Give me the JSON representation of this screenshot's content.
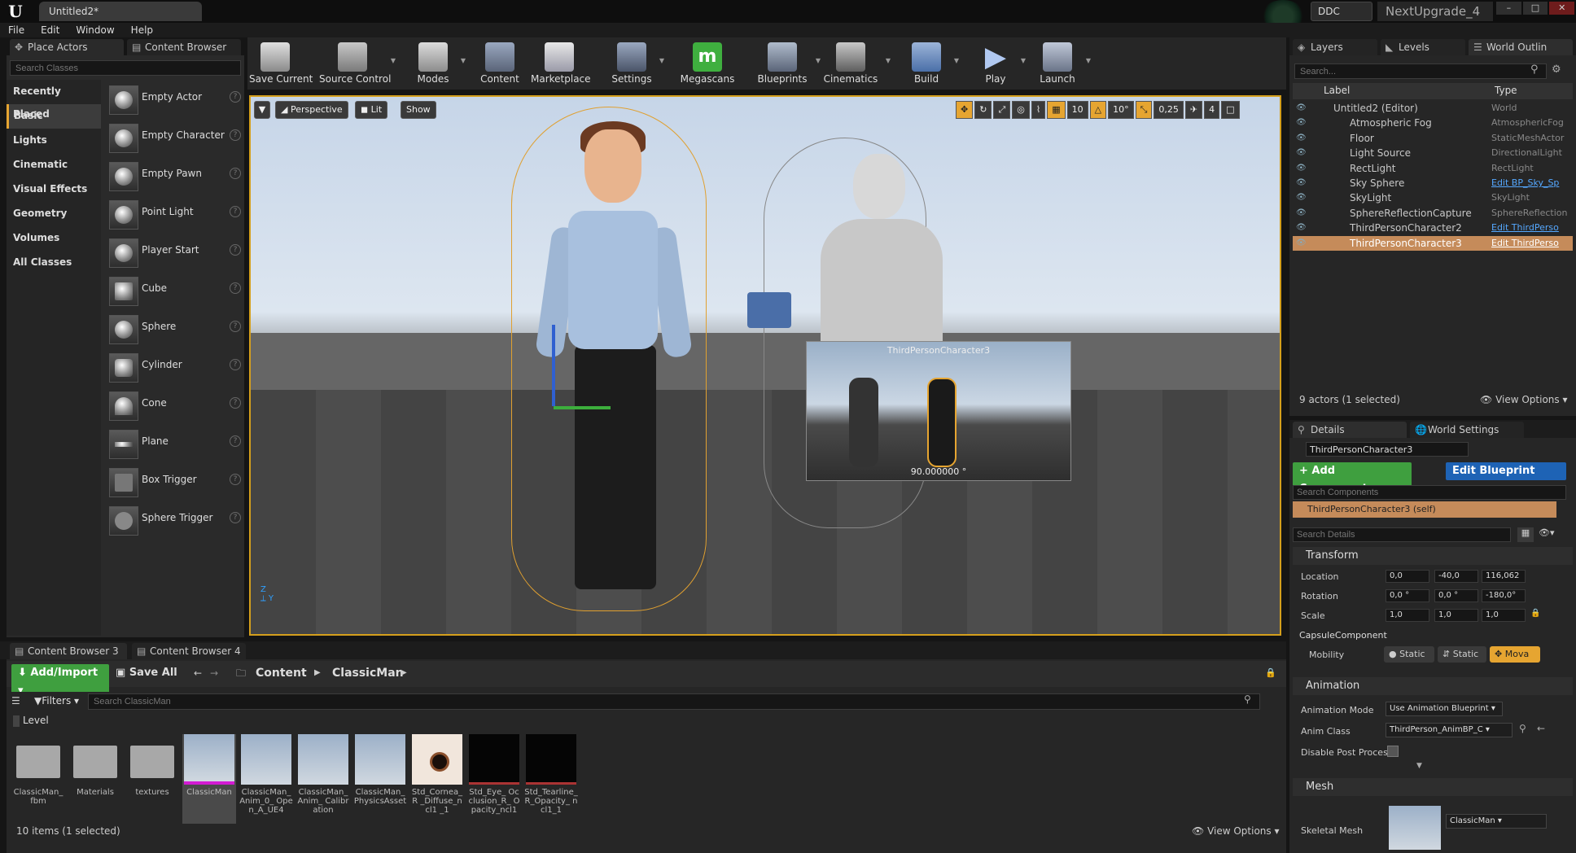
{
  "window": {
    "doc_tab": "Untitled2*",
    "ddc": "DDC",
    "project": "NextUpgrade_4",
    "controls": [
      "–",
      "□",
      "✕"
    ]
  },
  "menu": [
    "File",
    "Edit",
    "Window",
    "Help"
  ],
  "place_actors": {
    "tabs": [
      "Place Actors",
      "Content Browser"
    ],
    "search_placeholder": "Search Classes",
    "categories": [
      "Recently Placed",
      "Basic",
      "Lights",
      "Cinematic",
      "Visual Effects",
      "Geometry",
      "Volumes",
      "All Classes"
    ],
    "actors": [
      "Empty Actor",
      "Empty Character",
      "Empty Pawn",
      "Point Light",
      "Player Start",
      "Cube",
      "Sphere",
      "Cylinder",
      "Cone",
      "Plane",
      "Box Trigger",
      "Sphere Trigger"
    ]
  },
  "toolbar": {
    "buttons": [
      "Save Current",
      "Source Control",
      "Modes",
      "Content",
      "Marketplace",
      "Settings",
      "Megascans",
      "Blueprints",
      "Cinematics",
      "Build",
      "Play",
      "Launch"
    ]
  },
  "viewport": {
    "perspective": "Perspective",
    "lit": "Lit",
    "show": "Show",
    "grid_snap": "10",
    "rot_snap": "10°",
    "scale_snap": "0,25",
    "cam_speed": "4",
    "preview_title": "ThirdPersonCharacter3",
    "preview_angle": "90.000000 °"
  },
  "outliner": {
    "tabs": [
      "Layers",
      "Levels",
      "World Outlin"
    ],
    "search_placeholder": "Search...",
    "col_label": "Label",
    "col_type": "Type",
    "rows": [
      {
        "name": "Untitled2 (Editor)",
        "type": "World",
        "link": false
      },
      {
        "name": "Atmospheric Fog",
        "type": "AtmosphericFog",
        "link": false
      },
      {
        "name": "Floor",
        "type": "StaticMeshActor",
        "link": false
      },
      {
        "name": "Light Source",
        "type": "DirectionalLight",
        "link": false
      },
      {
        "name": "RectLight",
        "type": "RectLight",
        "link": false
      },
      {
        "name": "Sky Sphere",
        "type": "Edit BP_Sky_Sp",
        "link": true
      },
      {
        "name": "SkyLight",
        "type": "SkyLight",
        "link": false
      },
      {
        "name": "SphereReflectionCapture",
        "type": "SphereReflection",
        "link": false
      },
      {
        "name": "ThirdPersonCharacter2",
        "type": "Edit ThirdPerso",
        "link": true
      },
      {
        "name": "ThirdPersonCharacter3",
        "type": "Edit ThirdPerso",
        "link": true
      }
    ],
    "selected_index": 9,
    "status": "9 actors (1 selected)",
    "view_options": "View Options"
  },
  "details": {
    "tabs": [
      "Details",
      "World Settings"
    ],
    "name_field": "ThirdPersonCharacter3",
    "add_component": "+ Add Component",
    "edit_blueprint": "Edit Blueprint",
    "search_components": "Search Components",
    "self_row": "ThirdPersonCharacter3 (self)",
    "search_details": "Search Details",
    "transform_header": "Transform",
    "location_label": "Location",
    "location": [
      "0,0",
      "-40,0",
      "116,062"
    ],
    "rotation_label": "Rotation",
    "rotation": [
      "0,0 °",
      "0,0 °",
      "-180,0°"
    ],
    "scale_label": "Scale",
    "scale": [
      "1,0",
      "1,0",
      "1,0"
    ],
    "capsule_header": "CapsuleComponent",
    "mobility_label": "Mobility",
    "mobility_options": [
      "Static",
      "Static",
      "Mova"
    ],
    "animation_header": "Animation",
    "anim_mode_label": "Animation Mode",
    "anim_mode_value": "Use Animation Blueprint",
    "anim_class_label": "Anim Class",
    "anim_class_value": "ThirdPerson_AnimBP_C",
    "disable_post_label": "Disable Post Proces",
    "mesh_header": "Mesh",
    "skeletal_mesh_label": "Skeletal Mesh",
    "skeletal_mesh_value": "ClassicMan"
  },
  "content_browser": {
    "tabs": [
      "Content Browser 3",
      "Content Browser 4"
    ],
    "add_import": "Add/Import",
    "save_all": "Save All",
    "path": [
      "Content",
      "ClassicMan"
    ],
    "filters": "Filters",
    "search_placeholder": "Search ClassicMan",
    "level_label": "Level",
    "assets": [
      {
        "name": "ClassicMan_ fbm",
        "kind": "folder"
      },
      {
        "name": "Materials",
        "kind": "folder"
      },
      {
        "name": "textures",
        "kind": "folder"
      },
      {
        "name": "ClassicMan",
        "kind": "char"
      },
      {
        "name": "ClassicMan_ Anim_0_ Open_A_UE4",
        "kind": "char"
      },
      {
        "name": "ClassicMan_ Anim_ Calibration",
        "kind": "char"
      },
      {
        "name": "ClassicMan_ PhysicsAsset",
        "kind": "char"
      },
      {
        "name": "Std_Cornea_R _Diffuse_ncl1 _1",
        "kind": "eye"
      },
      {
        "name": "Std_Eye_ Occlusion_R_ Opacity_ncl1",
        "kind": "black"
      },
      {
        "name": "Std_Tearline_ R_Opacity_ ncl1_1",
        "kind": "black"
      }
    ],
    "selected_asset": 3,
    "status": "10 items (1 selected)",
    "view_options": "View Options"
  }
}
